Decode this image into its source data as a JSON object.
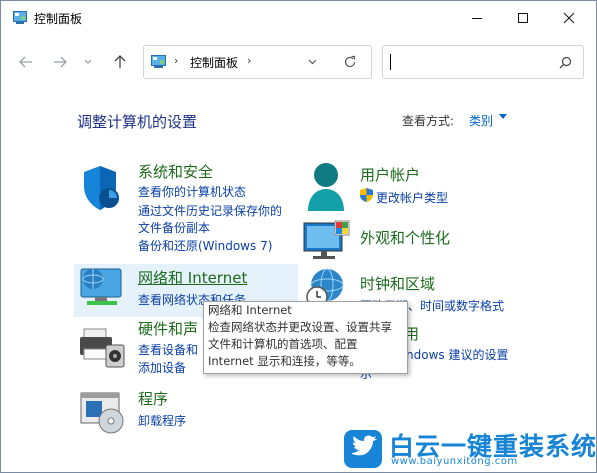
{
  "window": {
    "title": "控制面板"
  },
  "address": {
    "path": "控制面板",
    "search_placeholder": ""
  },
  "main": {
    "heading": "调整计算机的设置",
    "view_by_label": "查看方式:",
    "view_by_value": "类别"
  },
  "categories": {
    "security": {
      "title": "系统和安全",
      "links": [
        "查看你的计算机状态",
        "通过文件历史记录保存你的",
        "文件备份副本",
        "备份和还原(Windows 7)"
      ]
    },
    "network": {
      "title": "网络和 Internet",
      "links": [
        "查看网络状态和任务"
      ]
    },
    "hardware": {
      "title": "硬件和声",
      "links": [
        "查看设备和",
        "添加设备"
      ]
    },
    "programs": {
      "title": "程序",
      "links": [
        "卸载程序"
      ]
    },
    "accounts": {
      "title": "用户帐户",
      "links": [
        "更改帐户类型"
      ]
    },
    "appearance": {
      "title": "外观和个性化"
    },
    "clock": {
      "title": "时钟和区域",
      "links": [
        "更改日期、时间或数字格式"
      ]
    },
    "ease": {
      "title": "用",
      "links": [
        "ndows 建议的设置",
        "示"
      ]
    }
  },
  "tooltip": {
    "lines": [
      "网络和 Internet",
      "检查网络状态并更改设置、设置共享",
      "文件和计算机的首选项、配置",
      "Internet 显示和连接，等等。"
    ]
  },
  "watermark": {
    "text": "白云一键重装系统",
    "url": "www.baiyunxitong.com"
  },
  "colors": {
    "category_title": "#1c6a1c",
    "link": "#0a3fa6",
    "heading": "#1e3287",
    "watermark": "#1784d6"
  }
}
